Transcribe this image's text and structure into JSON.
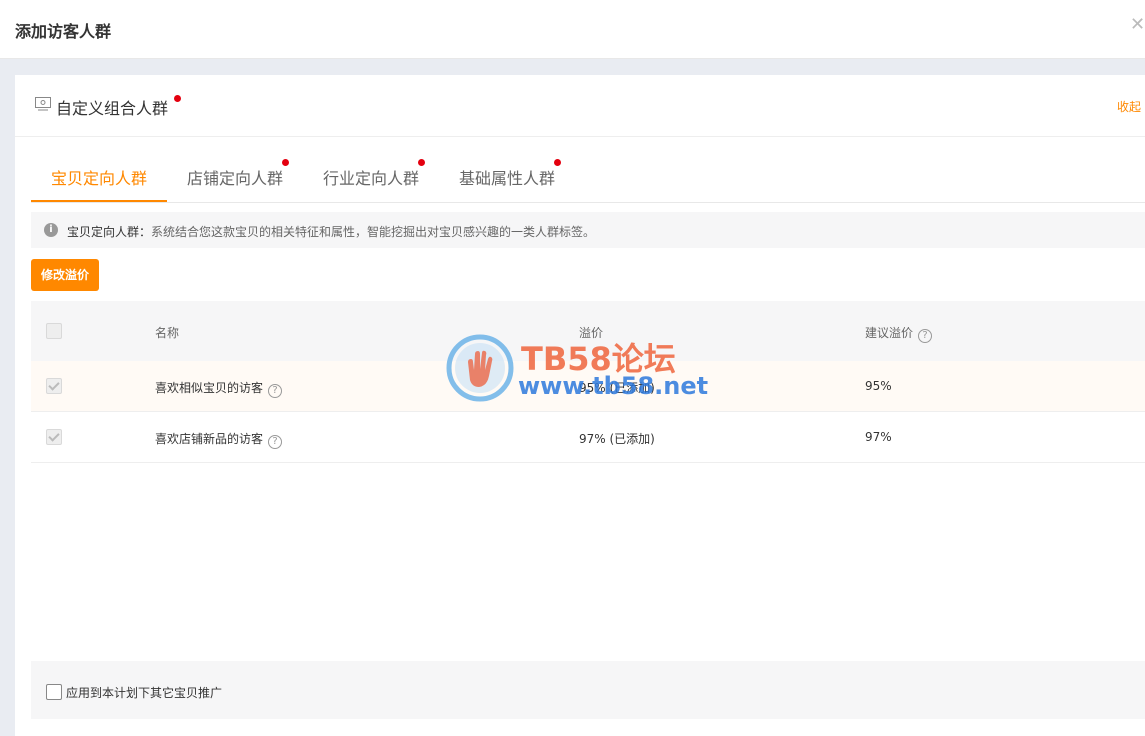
{
  "dialog": {
    "title": "添加访客人群",
    "close_icon": "close-icon"
  },
  "panel": {
    "title": "自定义组合人群",
    "collapse_label": "收起",
    "accent_color": "#ff8800",
    "dot_color": "#e4000f"
  },
  "tabs": [
    {
      "label": "宝贝定向人群",
      "active": true,
      "dot": false
    },
    {
      "label": "店铺定向人群",
      "active": false,
      "dot": true
    },
    {
      "label": "行业定向人群",
      "active": false,
      "dot": true
    },
    {
      "label": "基础属性人群",
      "active": false,
      "dot": true
    }
  ],
  "info": {
    "strong": "宝贝定向人群：",
    "text": "系统结合您这款宝贝的相关特征和属性，智能挖掘出对宝贝感兴趣的一类人群标签。"
  },
  "actions": {
    "modify_premium_label": "修改溢价"
  },
  "table": {
    "headers": {
      "name": "名称",
      "premium": "溢价",
      "suggested": "建议溢价"
    },
    "rows": [
      {
        "name": "喜欢相似宝贝的访客",
        "premium": "95% (已添加)",
        "suggested": "95%",
        "checked": true
      },
      {
        "name": "喜欢店铺新品的访客",
        "premium": "97% (已添加)",
        "suggested": "97%",
        "checked": true
      }
    ]
  },
  "footer": {
    "apply_label": "应用到本计划下其它宝贝推广",
    "apply_checked": false
  },
  "watermark": {
    "title": "TB58论坛",
    "url": "www.tb58.net"
  }
}
